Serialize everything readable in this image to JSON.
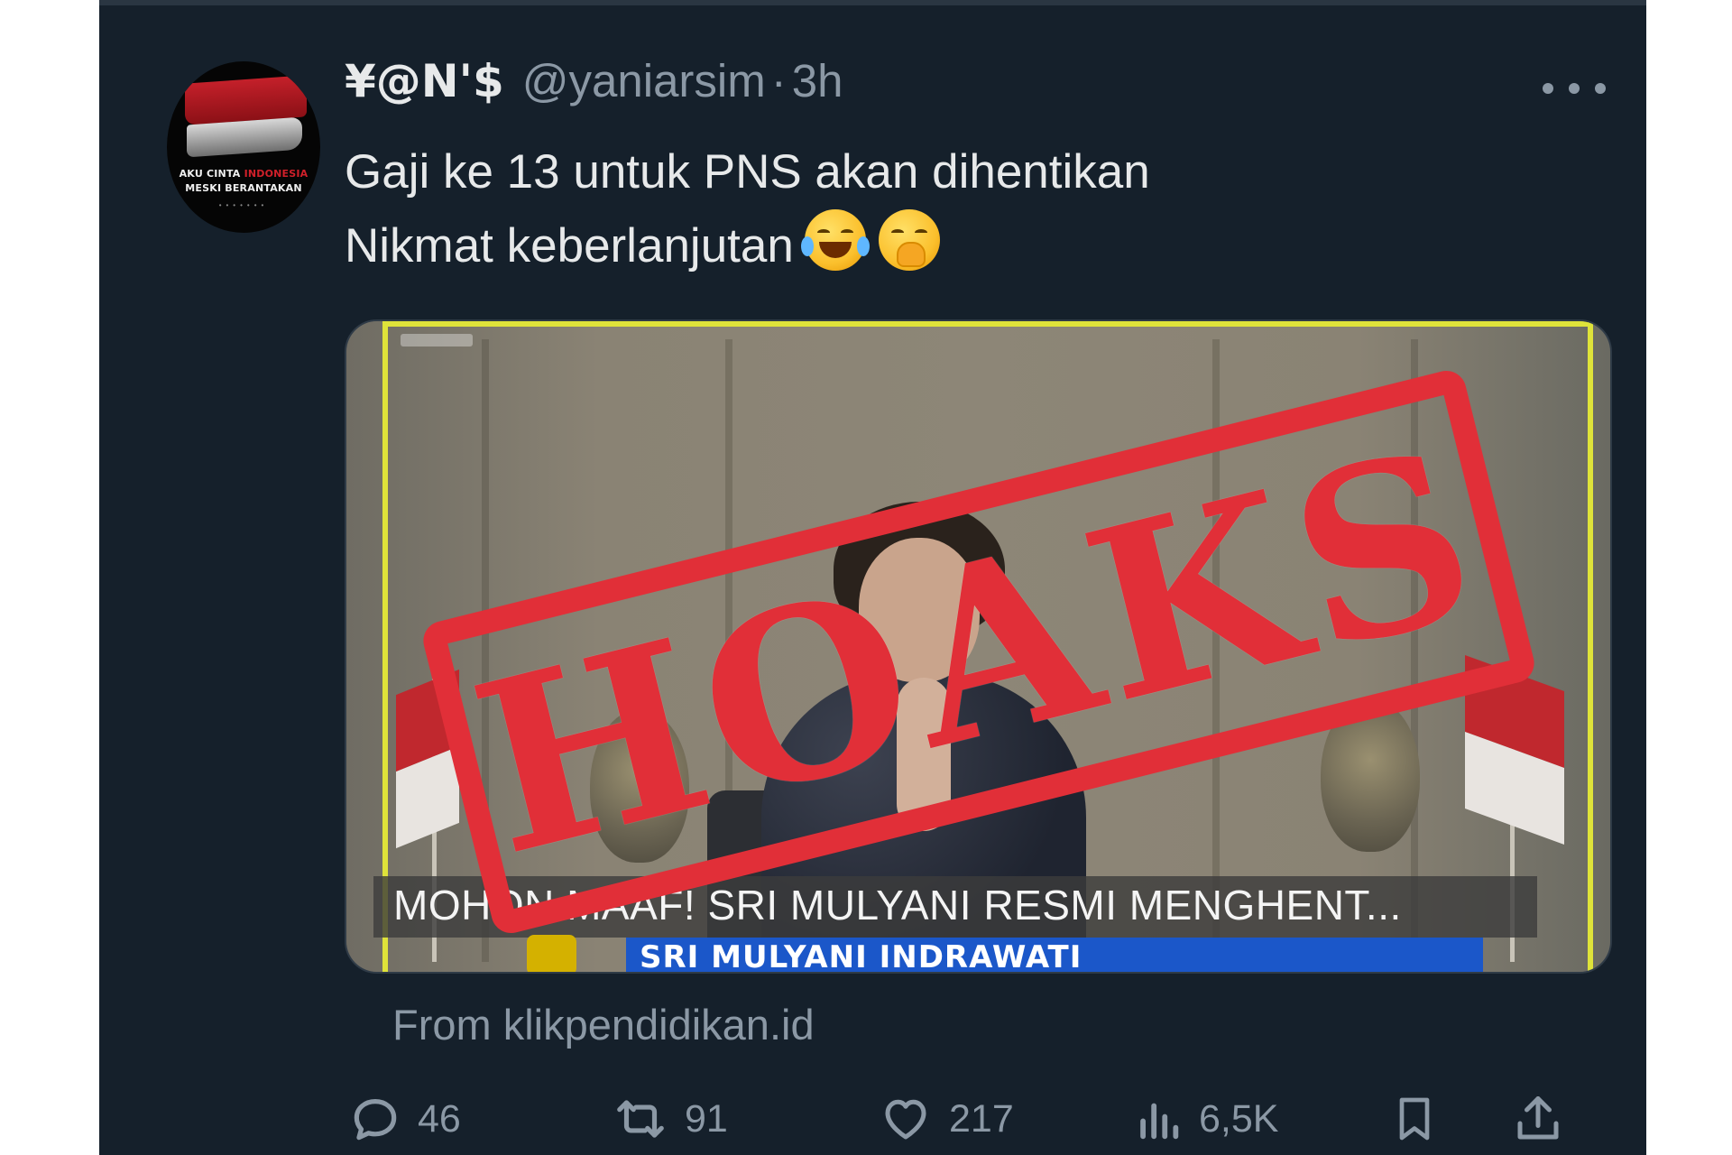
{
  "tweet": {
    "display_name": "¥@N'$",
    "handle": "@yaniarsim",
    "separator": "·",
    "time": "3h",
    "text_line1": "Gaji ke 13 untuk PNS akan dihentikan",
    "text_line2": "Nikmat keberlanjutan",
    "emojis": [
      "face-with-tears-of-joy-emoji",
      "face-with-hand-over-mouth-emoji"
    ],
    "more_icon": "more-horizontal-icon"
  },
  "avatar": {
    "line1_a": "AKU CINTA",
    "line1_b": "INDONESIA",
    "line2": "MESKI BERANTAKAN"
  },
  "media": {
    "caption": "MOHON MAAF! SRI MULYANI RESMI MENGHENT...",
    "lower_third": "SRI MULYANI INDRAWATI",
    "flag_colors": [
      "#c0282e",
      "#e8e4e0"
    ],
    "frame_color": "#dfe33a"
  },
  "source": {
    "text": "From klikpendidikan.id"
  },
  "actions": {
    "replies": "46",
    "retweets": "91",
    "likes": "217",
    "views": "6,5K",
    "icons": [
      "reply-icon",
      "retweet-icon",
      "like-icon",
      "views-icon",
      "bookmark-icon",
      "share-icon"
    ]
  },
  "stamp": {
    "text": "HOAKS",
    "color": "#e12f38"
  },
  "theme": {
    "background": "#15202b",
    "text_primary": "#e7e9ea",
    "text_secondary": "#8b98a5"
  }
}
